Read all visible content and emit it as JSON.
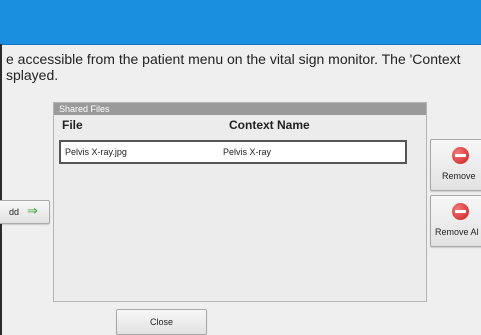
{
  "description": {
    "line1": "e accessible from the patient menu on the vital sign monitor. The 'Context",
    "line2": "splayed."
  },
  "shared_files": {
    "title": "Shared Files",
    "columns": [
      "File",
      "Context Name"
    ],
    "rows": [
      {
        "file": "Pelvis X-ray.jpg",
        "context": "Pelvis X-ray"
      }
    ]
  },
  "buttons": {
    "add": "dd",
    "add_icon": "green-arrow-right-icon",
    "remove": "Remove",
    "remove_all": "Remove Al",
    "remove_icon": "red-minus-icon",
    "close": "Close"
  },
  "colors": {
    "titlebar": "#1a8fe0",
    "add_arrow": "#3aa43a",
    "remove_icon": "#d01818"
  }
}
